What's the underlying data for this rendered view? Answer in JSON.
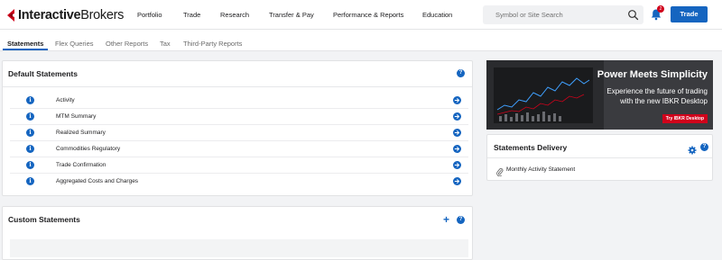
{
  "brand": {
    "name_bold": "Interactive",
    "name_light": "Brokers"
  },
  "nav": {
    "items": [
      "Portfolio",
      "Trade",
      "Research",
      "Transfer & Pay",
      "Performance & Reports",
      "Education"
    ]
  },
  "search": {
    "placeholder": "Symbol or Site Search"
  },
  "notifications": {
    "count": "2"
  },
  "trade_button": "Trade",
  "tabs": [
    "Statements",
    "Flex Queries",
    "Other Reports",
    "Tax",
    "Third-Party Reports"
  ],
  "default_statements": {
    "title": "Default Statements",
    "help": "?",
    "rows": [
      {
        "label": "Activity"
      },
      {
        "label": "MTM Summary"
      },
      {
        "label": "Realized Summary"
      },
      {
        "label": "Commodities Regulatory"
      },
      {
        "label": "Trade Confirmation"
      },
      {
        "label": "Aggregated Costs and Charges"
      }
    ]
  },
  "custom_statements": {
    "title": "Custom Statements",
    "help": "?"
  },
  "banner": {
    "title": "Power Meets Simplicity",
    "line1": "Experience the future of trading",
    "line2": "with the new IBKR Desktop",
    "cta": "Try IBKR Desktop"
  },
  "statements_delivery": {
    "title": "Statements Delivery",
    "help": "?",
    "items": [
      {
        "label": "Monthly Activity Statement"
      }
    ]
  },
  "colors": {
    "accent": "#1565c0",
    "alert": "#d0021b"
  },
  "icons": [
    "logo-icon",
    "search-icon",
    "bell-icon",
    "info-icon",
    "arrow-right-icon",
    "help-icon",
    "plus-icon",
    "gear-icon",
    "paperclip-icon"
  ]
}
